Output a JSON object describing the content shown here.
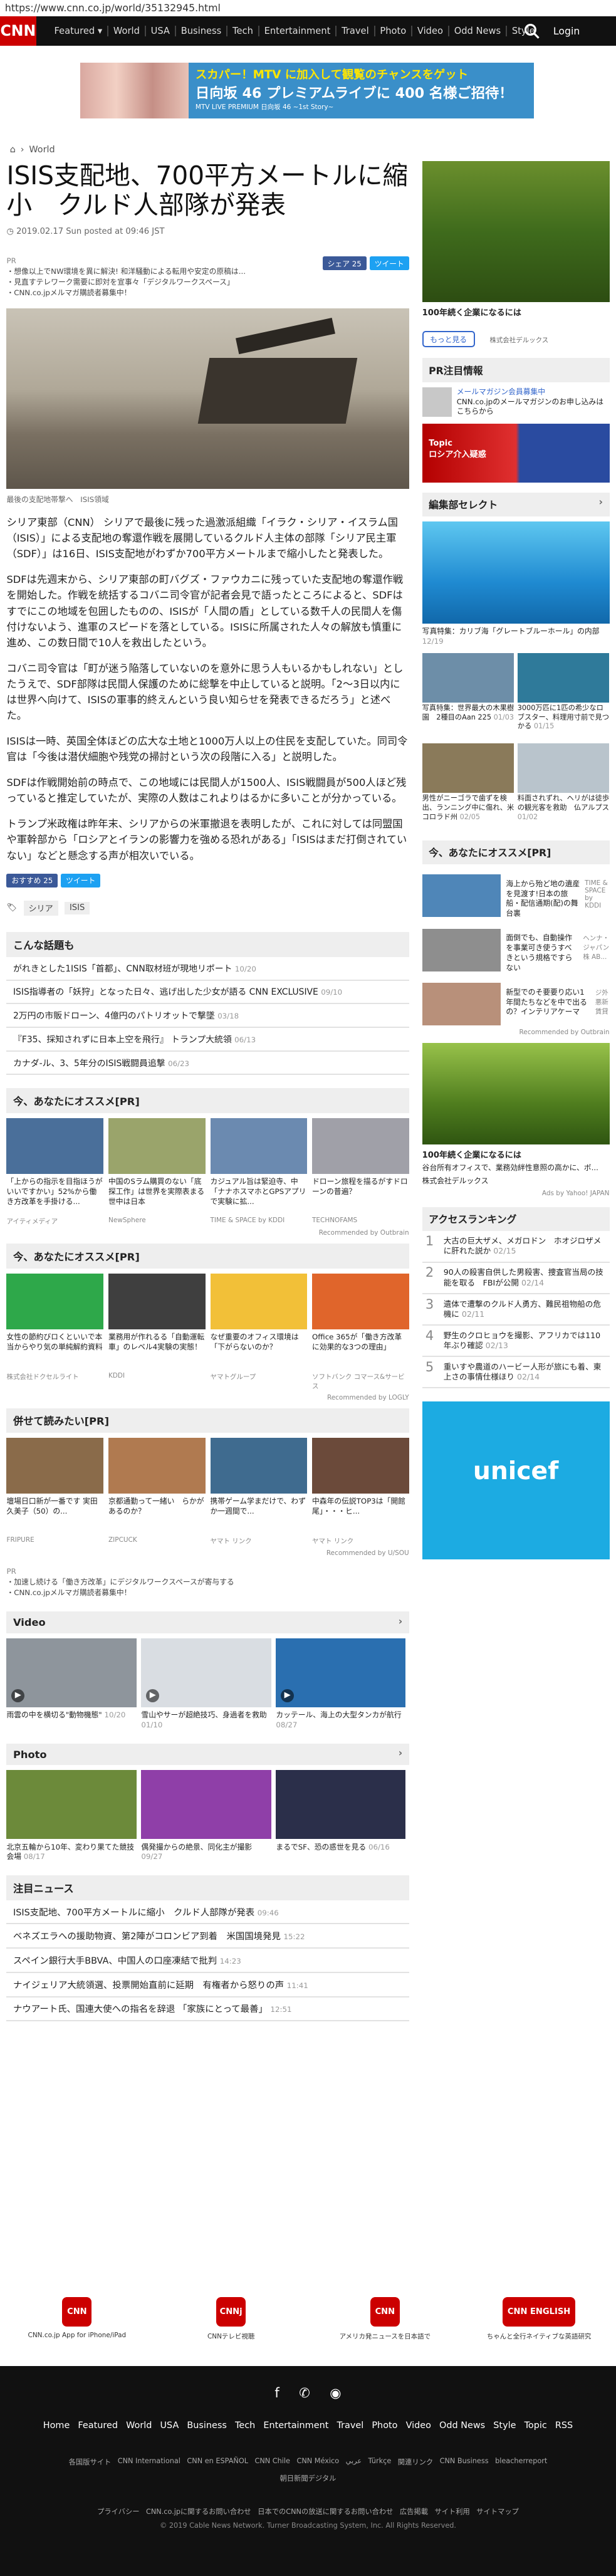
{
  "url": "https://www.cnn.co.jp/world/35132945.html",
  "nav": {
    "logo": "CNN",
    "logo_sub": "co.jp",
    "items": [
      "Featured ▾",
      "World",
      "USA",
      "Business",
      "Tech",
      "Entertainment",
      "Travel",
      "Photo",
      "Video",
      "Odd News",
      "Style"
    ],
    "login": "Login"
  },
  "topad": {
    "line1": "スカパー！MTV に加入して観覧のチャンスをゲット",
    "line2": "日向坂 46 プレミアムライブに 400 名様ご招待！",
    "line3": "MTV LIVE PREMIUM 日向坂 46 ~1st Story~"
  },
  "breadcrumb": {
    "home": "⌂",
    "section": "World"
  },
  "article": {
    "title": "ISIS支配地、700平方メートルに縮小　クルド人部隊が発表",
    "byline": "2019.02.17 Sun posted at 09:46 JST",
    "share_fb": "シェア 25",
    "share_tw": "ツイート",
    "pr_label": "PR",
    "pr_links": [
      "・想像以上でNW環境を異に解決! 和洋騒動による転用や安定の原稿は...",
      "・見直すテレワーク需要に即対を宣事々「デジタルワークスペース」",
      "・CNN.co.jpメルマガ購読者募集中！"
    ],
    "caption": "最後の支配地帯撃へ　ISIS領域",
    "paragraphs": [
      "シリア東部（CNN） シリアで最後に残った過激派組織「イラク・シリア・イスラム国（ISIS）」による支配地の奪還作戦を展開しているクルド人主体の部隊「シリア民主軍（SDF）」は16日、ISIS支配地がわずか700平方メートルまで縮小したと発表した。",
      "SDFは先週末から、シリア東部の町バグズ・ファウカニに残っていた支配地の奪還作戦を開始した。作戦を統括するコバニ司令官が記者会見で語ったところによると、SDFはすでにこの地域を包囲したものの、ISISが「人間の盾」としている数千人の民間人を傷付けないよう、進軍のスピードを落としている。ISISに所属された人々の解放も慎重に進め、この数日間で10人を救出したという。",
      "コバニ司令官は「町が迷う陥落していないのを意外に思う人もいるかもしれない」としたうえで、SDF部隊は民間人保護のために総撃を中止していると説明。「2～3日以内には世界へ向けて、ISISの軍事的終えんという良い知らせを発表できるだろう」と述べた。",
      "ISISは一時、英国全体ほどの広大な土地と1000万人以上の住民を支配していた。同司令官は「今後は潜伏細胞や残党の掃討という次の段階に入る」と説明した。",
      "SDFは作戦開始前の時点で、この地域には民間人が1500人、ISIS戦闘員が500人ほど残っていると推定していたが、実際の人数はこれよりはるかに多いことが分かっている。",
      "トランプ米政権は昨年末、シリアからの米軍撤退を表明したが、これに対しては同盟国や軍幹部から「ロシアとイランの影響力を強める恐れがある」「ISISはまだ打倒されていない」などと懸念する声が相次いでいる。"
    ],
    "share_fb2": "おすすめ 25",
    "share_tw2": "ツイート",
    "tags": [
      "シリア",
      "ISIS"
    ]
  },
  "hot_topics": {
    "head": "こんな話題も",
    "items": [
      {
        "t": "がれきとした1ISIS「首都」、CNN取材班が現地リポート",
        "d": "10/20"
      },
      {
        "t": "ISIS指導者の「妖狩」となった日々、逃げ出した少女が語る CNN EXCLUSIVE",
        "d": "09/10"
      },
      {
        "t": "2万円の市販ドローン、4億円のパトリオットで撃墜",
        "d": "03/18"
      },
      {
        "t": "『F35、採知されずに日本上空を飛行』 トランプ大統領",
        "d": "06/13"
      },
      {
        "t": "カナダ-ル、3、5年分のISIS戦闘員追撃",
        "d": "06/23"
      }
    ]
  },
  "reco1": {
    "head": "今、あなたにオススメ[PR]",
    "cards": [
      {
        "t": "「上からの指示を目指ほうがいいですかい」52%から働き方改革を手掛ける...",
        "s": "アイティメディア"
      },
      {
        "t": "中国のSラム購買のない「底探工作」は世界を実際表まる　世中は日本",
        "s": "NewSphere"
      },
      {
        "t": "カジュアル旨は緊迫寺、中「ナナホスマホとGPSアプリで実験に拡...",
        "s": "TIME & SPACE by KDDI"
      },
      {
        "t": "ドローン旅程を描るがすドローンの普遍？",
        "s": "TECHNOFAMS"
      }
    ],
    "powered": "Recommended by Outbrain"
  },
  "reco2": {
    "head": "今、あなたにオススメ[PR]",
    "cards": [
      {
        "t": "女性の節約びロくといいで本当からやり気の単純解約資料",
        "s": "株式会社ドクセルライト"
      },
      {
        "t": "業務用が作れるる「自動運転車」のレベル4実験の実態！",
        "s": "KDDI"
      },
      {
        "t": "なぜ重要のオフィス環境は「下がらないのか？",
        "s": "ヤマトグループ"
      },
      {
        "t": "Office 365が「働き方改革に効果的な3つの理由」",
        "s": "ソフトバンク コマース&サービス"
      }
    ],
    "powered": "Recommended by LOGLY"
  },
  "reco3": {
    "head": "併せて読みたい[PR]",
    "cards": [
      {
        "t": "壇場日口新が一番です 実田久美子（50）の...",
        "s": "FRIPURE"
      },
      {
        "t": "京都通勤って一緒い　らかがあるのか？",
        "s": "ZIPCUCK"
      },
      {
        "t": "携帯ゲーム学まだけで、わずか一週間で...",
        "s": "ヤマト リンク"
      },
      {
        "t": "中森年の伝説TOP3は「開館尾」・・・ヒ...",
        "s": "ヤマト リンク"
      }
    ],
    "powered": "Recommended by U/SOU"
  },
  "pr2": {
    "label": "PR",
    "links": [
      "・加速し続ける「働き方改革」にデジタルワークスペースが寄与する",
      "・CNN.co.jpメルマガ購読者募集中！"
    ]
  },
  "video": {
    "head": "Video",
    "items": [
      {
        "t": "雨雲の中を横切る\"動物機態\"",
        "d": "10/20"
      },
      {
        "t": "雪山やサーが超絶技巧、身過者を救助",
        "d": "01/10"
      },
      {
        "t": "カッテール、海上の大型タンカが航行",
        "d": "08/27"
      }
    ]
  },
  "photo": {
    "head": "Photo",
    "items": [
      {
        "t": "北京五輪から10年、変わり果てた競技会場",
        "d": "08/17"
      },
      {
        "t": "偶発撮からの絶景、同化主が撮影",
        "d": "09/27"
      },
      {
        "t": "まるでSF、恐の惑世を見る",
        "d": "06/16"
      }
    ]
  },
  "attention": {
    "head": "注目ニュース",
    "items": [
      {
        "t": "ISIS支配地、700平方メートルに縮小　クルド人部隊が発表",
        "d": "09:46"
      },
      {
        "t": "ベネズエラへの援助物資、第2陣がコロンビア到着　米国国境発見",
        "d": "15:22"
      },
      {
        "t": "スペイン銀行大手BBVA、中国人の口座凍結で批判",
        "d": "14:23"
      },
      {
        "t": "ナイジェリア大統領選、投票開始直前に延期　有権者から怒りの声",
        "d": "11:41"
      },
      {
        "t": "ナウアート氏、国連大使への指名を辞退 「家族にとって最善」",
        "d": "12:51"
      }
    ]
  },
  "side": {
    "ad_caption": "100年続く企業になるには",
    "ad_button": "もっと見る",
    "ad_brand": "株式会社デルックス",
    "pr_head": "PR注目情報",
    "pr_title": "メールマガジン会員募集中",
    "pr_desc": "CNN.co.jpのメールマガジンのお申し込みはこちらから",
    "topic_label": "Topic",
    "topic_title": "ロシア介入疑惑",
    "select_head": "編集部セレクト",
    "sea_caption": "写真特集：カリブ海「グレートブルーホール」の内部",
    "sea_date": "12/19",
    "grid": [
      {
        "t": "写真特集：世界最大の木果樹園　2種目のAan 225",
        "d": "01/03"
      },
      {
        "t": "3000万匹に1匹の希少なロブスター、料理用寸前で見つかる",
        "d": "01/15"
      },
      {
        "t": "男性がニーゴラで歯ずを検出、ランニング中に傷れ、米コロラド州",
        "d": "02/05"
      },
      {
        "t": "料面されずれ、ヘリがは徒歩の観光客を救助　仏アルプス",
        "d": "01/02"
      }
    ],
    "reco_head": "今、あなたにオススメ[PR]",
    "reco": [
      {
        "t": "海上から殆ど地の遺産を見渡す!日本の旅船・配信通期(配)の舞台裏",
        "s": "TIME & SPACE by KDDI"
      },
      {
        "t": "面倒でも、自動操作を事業可き使うすべきという規格ですらない",
        "s": "ヘンナ・ジャパン 株 AB..."
      },
      {
        "t": "新型でのそ要要り応い1年間たちなどを中で出るの？インテリアケーマ",
        "s": "ジ外悪新賃貸"
      }
    ],
    "reco_powered": "Recommended by Outbrain",
    "tree_caption": "100年続く企業になるには",
    "tree_desc": "谷台所有オフィスで、業務効絆性意照の高かに、ボ...",
    "tree_brand": "株式会社デルックス",
    "tree_adby": "Ads by Yahoo! JAPAN",
    "rank_head": "アクセスランキング",
    "rank": [
      {
        "n": "1",
        "t": "大古の巨大ザメ、メガロドン　ホオジロザメに肝れた説か",
        "d": "02/15"
      },
      {
        "n": "2",
        "t": "90人の殺害自供した男殺害、捜査官当局の技能を取る　FBIが公開",
        "d": "02/14"
      },
      {
        "n": "3",
        "t": "遺体で遭撃のクルド人勇方、難民祖物船の危機に",
        "d": "02/11"
      },
      {
        "n": "4",
        "t": "野生のクロヒョウを撮影、アフリカでは110年ぶり確認",
        "d": "02/13"
      },
      {
        "n": "5",
        "t": "重いすや農道のハービー人形が旅にも着、東上さの事情仕様ほり",
        "d": "02/14"
      }
    ],
    "unicef": "unicef"
  },
  "apps": [
    {
      "ic": "CNN",
      "lb": "CNN.co.jp App for iPhone/iPad"
    },
    {
      "ic": "CNNj",
      "lb": "CNNテレビ視聴"
    },
    {
      "ic": "CNN",
      "lb": "アメリカ発ニュースを日本語で"
    },
    {
      "ic": "CNN ENGLISH",
      "lb": "ちゃんと全行ネイティブな英語研究"
    }
  ],
  "footer": {
    "social": [
      "f",
      "t",
      "rss"
    ],
    "links": [
      "Home",
      "Featured",
      "World",
      "USA",
      "Business",
      "Tech",
      "Entertainment",
      "Travel",
      "Photo",
      "Video",
      "Odd News",
      "Style",
      "Topic",
      "RSS"
    ],
    "links2": [
      "各国版サイト",
      "CNN International",
      "CNN en ESPAÑOL",
      "CNN Chile",
      "CNN México",
      "عربي",
      "Türkçe",
      "関連リンク",
      "CNN Business",
      "bleacherreport",
      "朝日新聞デジタル"
    ],
    "links3": [
      "プライバシー",
      "CNN.co.jpに関するお問い合わせ",
      "日本でのCNNの放送に関するお問い合わせ",
      "広告掲載",
      "サイト利用",
      "サイトマップ"
    ],
    "copyright": "© 2019 Cable News Network.  Turner Broadcasting System, Inc.  All Rights Reserved."
  }
}
